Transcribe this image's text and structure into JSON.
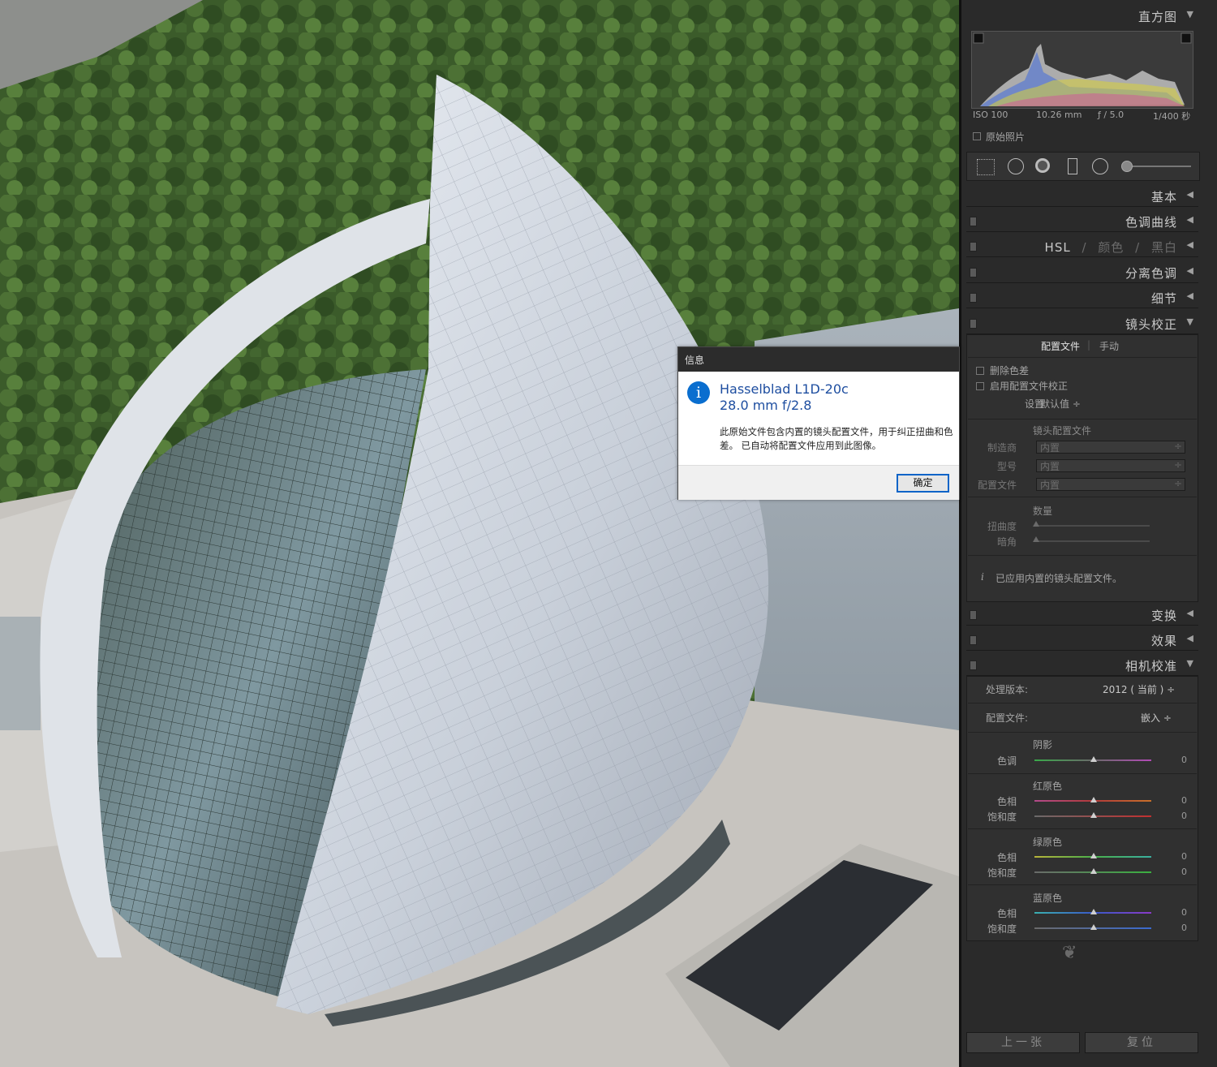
{
  "histogram": {
    "title": "直方图",
    "iso": "ISO 100",
    "focal": "10.26 mm",
    "aperture": "ƒ / 5.0",
    "shutter": "1/400 秒",
    "original_photo_label": "原始照片"
  },
  "sections": {
    "basic": "基本",
    "tone_curve": "色调曲线",
    "hsl": "HSL",
    "hsl_sep": "/",
    "color": "颜色",
    "bw": "黑白",
    "split_toning": "分离色调",
    "detail": "细节",
    "lens_corrections": "镜头校正",
    "transform": "变换",
    "effects": "效果",
    "camera_calibration": "相机校准"
  },
  "lens": {
    "tab_profile": "配置文件",
    "tab_sep": "|",
    "tab_manual": "手动",
    "remove_ca": "删除色差",
    "enable_profile": "启用配置文件校正",
    "setup_label": "设置",
    "setup_value": "默认值 ÷",
    "lens_profile_title": "镜头配置文件",
    "make_label": "制造商",
    "make_value": "内置",
    "model_label": "型号",
    "model_value": "内置",
    "profile_label": "配置文件",
    "profile_value": "内置",
    "amount_title": "数量",
    "distortion_label": "扭曲度",
    "vignetting_label": "暗角",
    "info_icon": "i",
    "info_text": "已应用内置的镜头配置文件。"
  },
  "calibration": {
    "process_label": "处理版本:",
    "process_value": "2012 ( 当前 ) ÷",
    "profile_label": "配置文件:",
    "profile_value": "嵌入 ÷",
    "shadows_title": "阴影",
    "tint_label": "色调",
    "red_title": "红原色",
    "green_title": "绿原色",
    "blue_title": "蓝原色",
    "hue_label": "色相",
    "sat_label": "饱和度",
    "values": {
      "shadow_tint": "0",
      "red_hue": "0",
      "red_sat": "0",
      "green_hue": "0",
      "green_sat": "0",
      "blue_hue": "0",
      "blue_sat": "0"
    }
  },
  "ornament": "❦",
  "buttons": {
    "previous": "上一张",
    "reset": "复位"
  },
  "dialog": {
    "title": "信息",
    "icon": "i",
    "camera": "Hasselblad L1D-20c",
    "lens": "28.0 mm f/2.8",
    "message": "此原始文件包含内置的镜头配置文件，用于纠正扭曲和色差。 已自动将配置文件应用到此图像。",
    "ok": "确定"
  },
  "colors": {
    "accent": "#0a6ecf",
    "panel_bg": "#2a2a2a",
    "dialog_title": "#1e4ea0"
  }
}
